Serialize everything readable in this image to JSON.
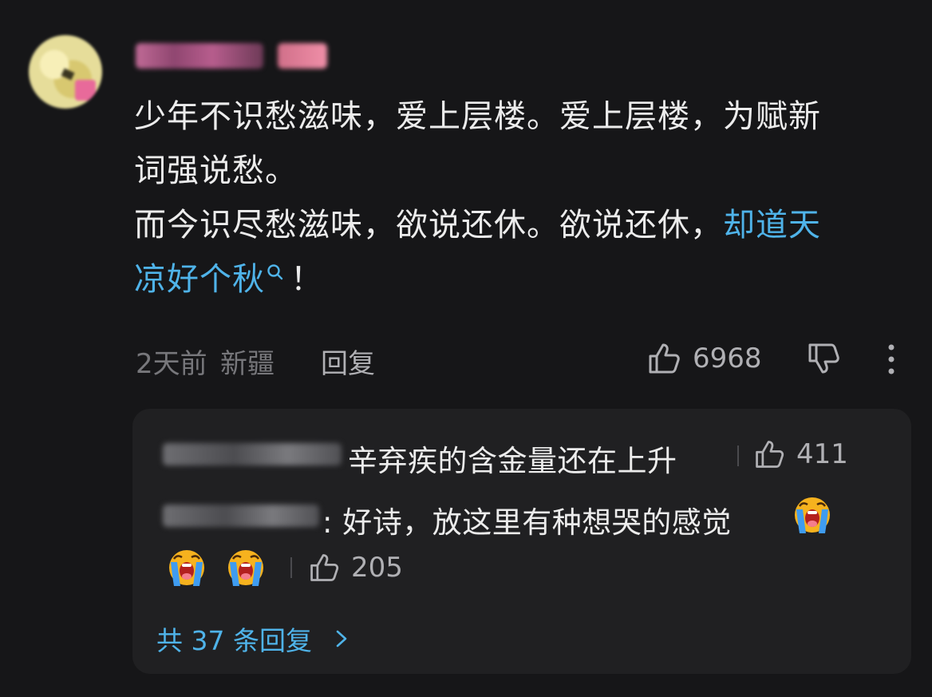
{
  "comment": {
    "line1": "少年不识愁滋味，爱上层楼。爱上层楼，为赋新",
    "line2": "词强说愁。",
    "line3_plain": "而今识尽愁滋味，欲说还休。欲说还休，",
    "line3_link": "却道天",
    "line4_link": "凉好个秋",
    "line4_end": "！",
    "time": "2天前",
    "location": "新疆",
    "reply_label": "回复",
    "likes": "6968"
  },
  "replies": [
    {
      "text": "辛弃疾的含金量还在上升",
      "likes": "411"
    },
    {
      "text": ": 好诗，放这里有种想哭的感觉",
      "likes": "205"
    }
  ],
  "view_all_label": "共 37 条回复",
  "colors": {
    "background": "#161618",
    "reply_panel": "#202022",
    "link": "#4fb3e9",
    "text": "#ececec",
    "muted": "#77777b"
  },
  "icons": [
    "avatar",
    "search-icon",
    "thumbs-up-icon",
    "thumbs-down-icon",
    "more-icon",
    "crying-emoji",
    "chevron-right-icon"
  ]
}
